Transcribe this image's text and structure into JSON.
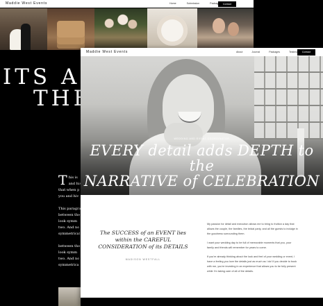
{
  "back_page": {
    "brand": "Maddie West Events",
    "nav": [
      "Home",
      "Submission",
      "Packages"
    ],
    "contact": "Contact",
    "headline": [
      "ITS AL",
      "THE"
    ],
    "body": [
      [
        "his is",
        "and his",
        "that when p",
        "you and hiv"
      ],
      [
        "This paragra",
        "between the",
        "look symm",
        "two. And no",
        "symmetrical"
      ],
      [
        "between the",
        "look symm",
        "two. And no",
        "symmetrica"
      ]
    ],
    "dropcap": "T"
  },
  "front_page": {
    "brand": "Maddie West Events",
    "nav": [
      "About",
      "Journal",
      "Packages",
      "Testimonials"
    ],
    "contact": "Contact",
    "hero_kicker": "WEDDING AND EVENT COORDINATOR",
    "hero_title": [
      "EVERY detail adds DEPTH to the",
      "NARRATIVE of CELEBRATION"
    ],
    "quote": [
      "The SUCCESS of an EVENT lies",
      "within the CAREFUL",
      "CONSIDERATION of its DETAILS"
    ],
    "quote_author": "MADISON WESTFALL",
    "paragraphs": [
      [
        "My passion for detail and execution allows me to bring to fruition a day that",
        "allows the couple, the families, the bridal party, and all the guests to indulge in",
        "the goodness surrounding them."
      ],
      [
        "I want your wedding day to be full of memorable moments that you, your",
        "family and friends will remember for years to come."
      ],
      [
        "If you're already thinking about the look and feel of your wedding or event, I",
        "have a feeling you love the details just as much as I do! If you decide to book",
        "with me, you're investing in an experience that allows you to be fully present",
        "while I'm taking care of all of the details."
      ]
    ]
  }
}
